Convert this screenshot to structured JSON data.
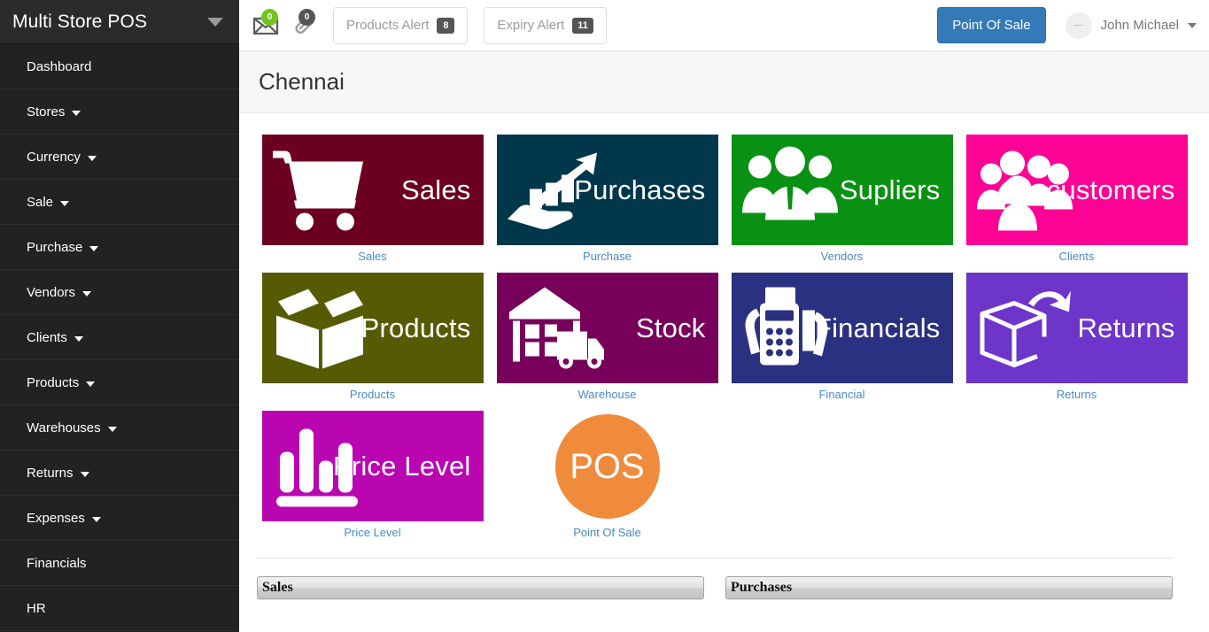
{
  "sidebar": {
    "brand": "Multi Store POS",
    "brand_caret_icon": "chevron-down-icon",
    "items": [
      {
        "label": "Dashboard",
        "has_caret": false
      },
      {
        "label": "Stores",
        "has_caret": true
      },
      {
        "label": "Currency",
        "has_caret": true
      },
      {
        "label": "Sale",
        "has_caret": true
      },
      {
        "label": "Purchase",
        "has_caret": true
      },
      {
        "label": "Vendors",
        "has_caret": true
      },
      {
        "label": "Clients",
        "has_caret": true
      },
      {
        "label": "Products",
        "has_caret": true
      },
      {
        "label": "Warehouses",
        "has_caret": true
      },
      {
        "label": "Returns",
        "has_caret": true
      },
      {
        "label": "Expenses",
        "has_caret": true
      },
      {
        "label": "Financials",
        "has_caret": false
      },
      {
        "label": "HR",
        "has_caret": false
      }
    ]
  },
  "topbar": {
    "mail_icon": "envelope-icon",
    "mail_count": "0",
    "mail_badge_color": "#73c41d",
    "attachment_icon": "paperclip-icon",
    "attachment_count": "0",
    "attachment_badge_color": "#555555",
    "products_alert_label": "Products Alert",
    "products_alert_count": "8",
    "expiry_alert_label": "Expiry Alert",
    "expiry_alert_count": "11",
    "pos_button_label": "Point Of Sale",
    "pos_button_color": "#337ab7",
    "avatar_icon": "avatar-icon",
    "user_name": "John Michael",
    "user_caret_icon": "chevron-down-icon"
  },
  "page": {
    "title": "Chennai"
  },
  "tiles": [
    {
      "tile_text": "Sales",
      "caption": "Sales",
      "color": "#6B0020",
      "icon": "shopping-cart-icon"
    },
    {
      "tile_text": "Purchases",
      "caption": "Purchase",
      "color": "#01374A",
      "icon": "growth-arrow-hand-icon"
    },
    {
      "tile_text": "Supliers",
      "caption": "Vendors",
      "color": "#089112",
      "icon": "people-group-icon"
    },
    {
      "tile_text": "customers",
      "caption": "Clients",
      "color": "#FC0295",
      "icon": "customers-group-icon"
    },
    {
      "tile_text": "Products",
      "caption": "Products",
      "color": "#565B03",
      "icon": "open-box-icon"
    },
    {
      "tile_text": "Stock",
      "caption": "Warehouse",
      "color": "#77005B",
      "icon": "warehouse-truck-icon"
    },
    {
      "tile_text": "Financials",
      "caption": "Financial",
      "color": "#2A3180",
      "icon": "card-terminal-icon"
    },
    {
      "tile_text": "Returns",
      "caption": "Returns",
      "color": "#6D35C9",
      "icon": "return-box-arrow-icon"
    },
    {
      "tile_text": "Price Level",
      "caption": "Price Level",
      "color": "#BA06B1",
      "icon": "bar-chart-icon"
    }
  ],
  "pos_tile": {
    "text": "POS",
    "caption": "Point Of Sale",
    "color": "#EF8B3B",
    "icon": "pos-circle-icon"
  },
  "panels": [
    {
      "title": "Sales"
    },
    {
      "title": "Purchases"
    }
  ],
  "caption_color": "#4a8ac4"
}
